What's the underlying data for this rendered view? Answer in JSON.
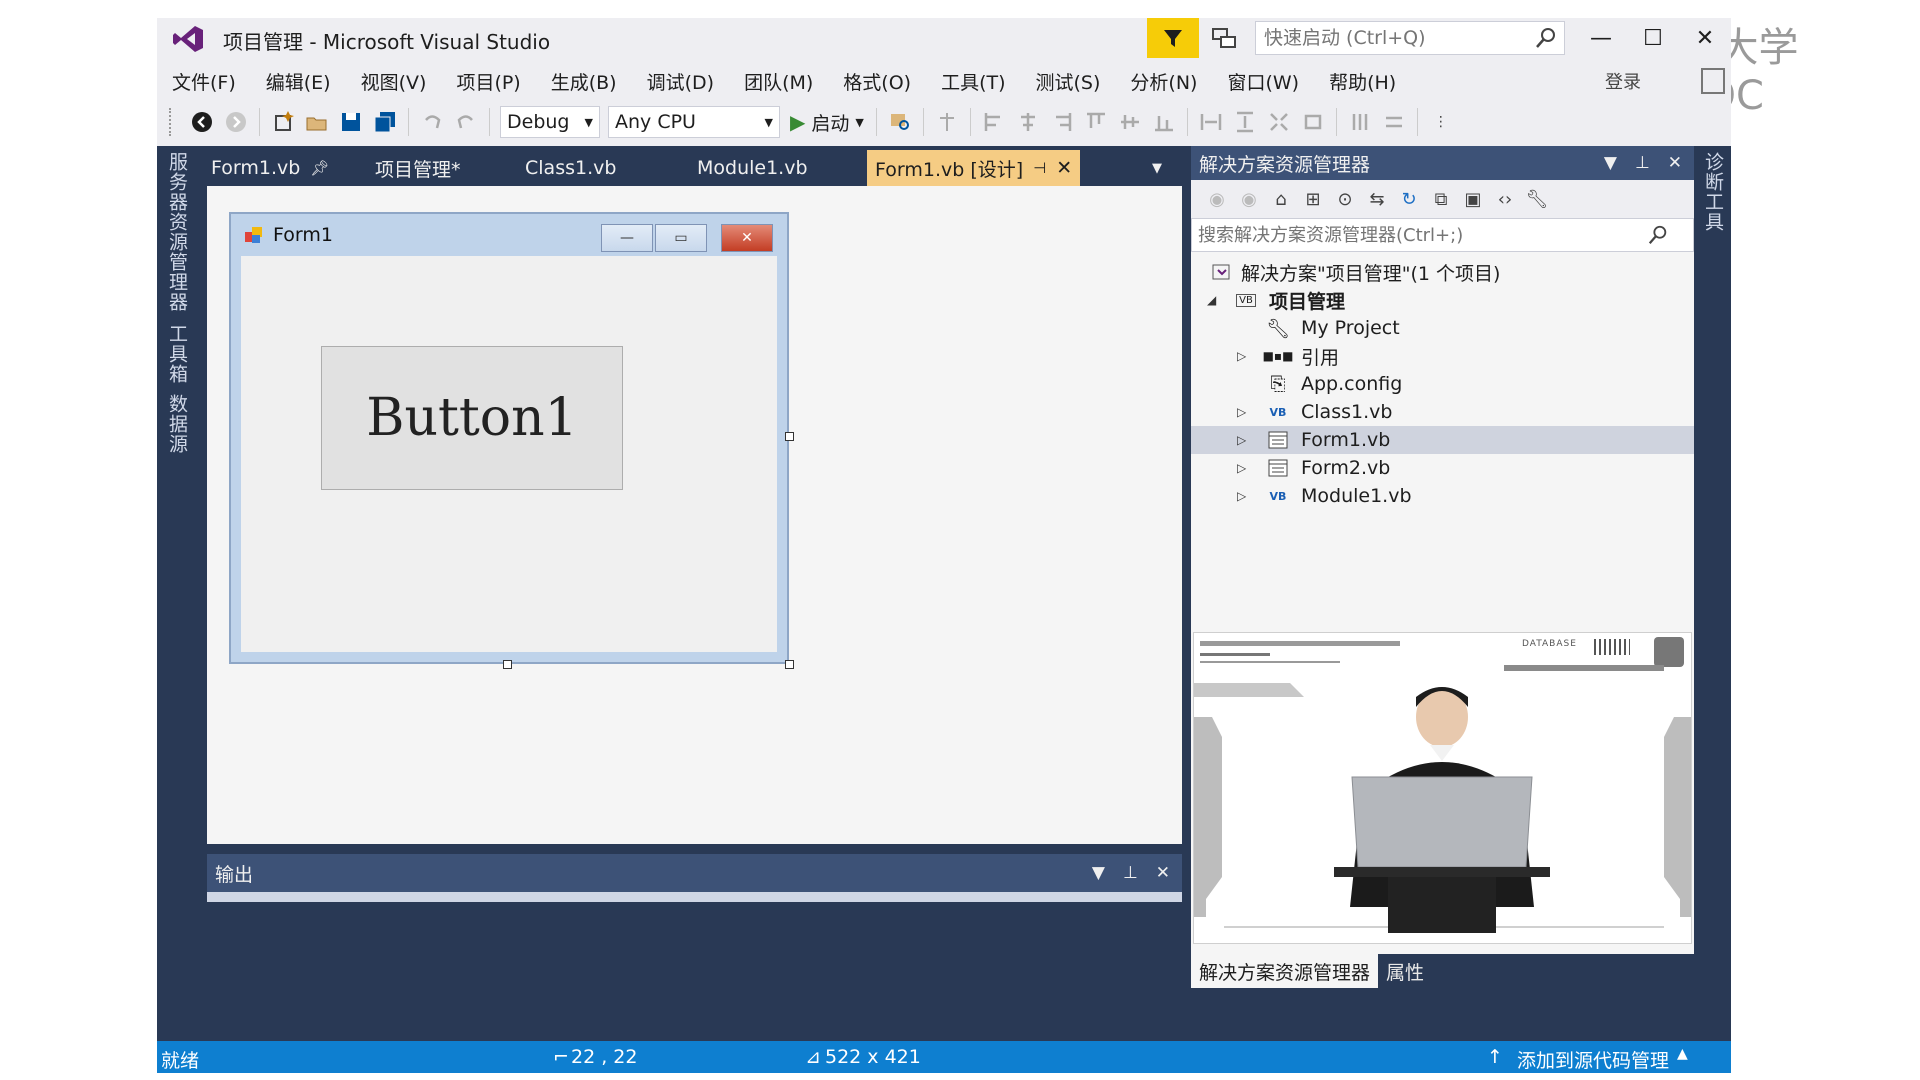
{
  "watermark": {
    "text": "中国大学MOOC"
  },
  "window": {
    "title": "项目管理 - Microsoft Visual Studio",
    "quick_launch_placeholder": "快速启动 (Ctrl+Q)",
    "login": "登录",
    "accent": "#f6cc08",
    "status_color": "#0e7fd0"
  },
  "menu": [
    "文件(F)",
    "编辑(E)",
    "视图(V)",
    "项目(P)",
    "生成(B)",
    "调试(D)",
    "团队(M)",
    "格式(O)",
    "工具(T)",
    "测试(S)",
    "分析(N)",
    "窗口(W)",
    "帮助(H)"
  ],
  "toolbar": {
    "config": "Debug",
    "platform": "Any CPU",
    "start": "启动"
  },
  "side_tabs_left": [
    "服务器资源管理器",
    "工具箱",
    "数据源"
  ],
  "side_tabs_right": [
    "诊断工具"
  ],
  "doc_tabs": [
    {
      "label": "Form1.vb",
      "pinned": true
    },
    {
      "label": "项目管理*"
    },
    {
      "label": "Class1.vb"
    },
    {
      "label": "Module1.vb"
    },
    {
      "label": "Form1.vb [设计]",
      "active": true
    }
  ],
  "designer": {
    "form_title": "Form1",
    "button_text": "Button1"
  },
  "output": {
    "title": "输出"
  },
  "solution_explorer": {
    "title": "解决方案资源管理器",
    "search_placeholder": "搜索解决方案资源管理器(Ctrl+;)",
    "tree": [
      {
        "label": "解决方案\"项目管理\"(1 个项目)",
        "icon": "solution-icon"
      },
      {
        "label": "项目管理",
        "icon": "vb-project-icon",
        "bold": true,
        "expanded": true
      },
      {
        "label": "My Project",
        "icon": "wrench-icon"
      },
      {
        "label": "引用",
        "icon": "references-icon",
        "expandable": true
      },
      {
        "label": "App.config",
        "icon": "config-icon"
      },
      {
        "label": "Class1.vb",
        "icon": "vb-file-icon",
        "expandable": true
      },
      {
        "label": "Form1.vb",
        "icon": "form-icon",
        "expandable": true,
        "selected": true
      },
      {
        "label": "Form2.vb",
        "icon": "form-icon",
        "expandable": true
      },
      {
        "label": "Module1.vb",
        "icon": "vb-file-icon",
        "expandable": true
      }
    ],
    "video_banner": "DATABASE",
    "bottom_tabs": [
      "解决方案资源管理器",
      "属性"
    ]
  },
  "status": {
    "ready": "就绪",
    "position": "22 , 22",
    "size": "522 x 421",
    "source_control": "添加到源代码管理"
  }
}
